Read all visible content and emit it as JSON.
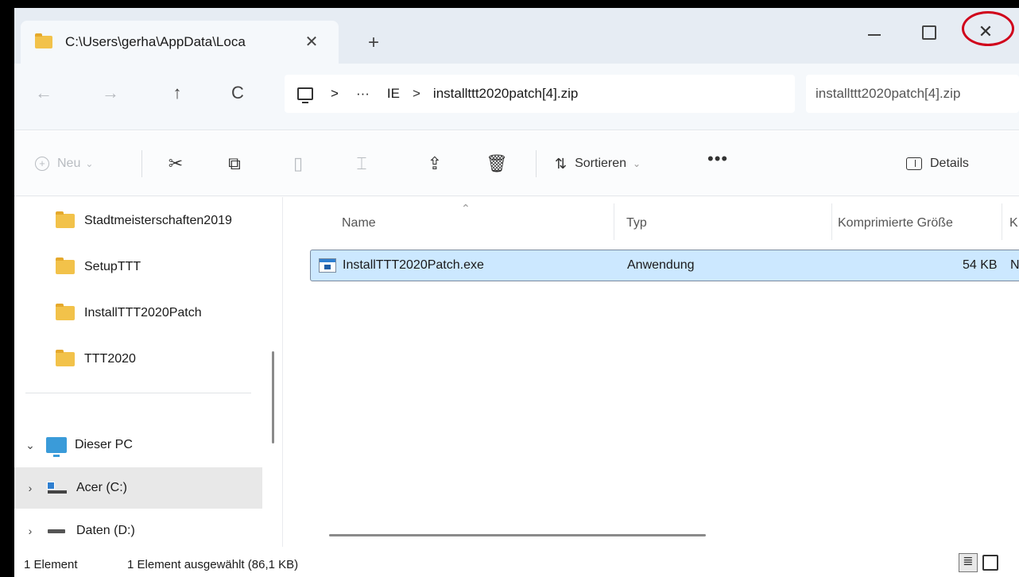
{
  "tab": {
    "title": "C:\\Users\\gerha\\AppData\\Loca",
    "close": "✕",
    "new_tab": "+"
  },
  "window_controls": {
    "close": "✕"
  },
  "nav": {
    "back": "←",
    "forward": "→",
    "up": "↑",
    "refresh": "C"
  },
  "address": {
    "separator": ">",
    "overflow": "···",
    "segment_ie": "IE",
    "segment_zip": "installttt2020patch[4].zip"
  },
  "search": {
    "placeholder": "installttt2020patch[4].zip"
  },
  "commands": {
    "new_label": "Neu",
    "cut_icon": "scissors-icon",
    "copy_icon": "copy-icon",
    "paste_icon": "paste-icon",
    "rename_icon": "rename-icon",
    "share_icon": "share-icon",
    "delete_icon": "trash-icon",
    "sort_label": "Sortieren",
    "more": "•••",
    "details_label": "Details"
  },
  "sidebar": {
    "folders": [
      {
        "label": "Stadtmeisterschaften2019"
      },
      {
        "label": "SetupTTT"
      },
      {
        "label": "InstallTTT2020Patch"
      },
      {
        "label": "TTT2020"
      }
    ],
    "this_pc": "Dieser PC",
    "drives": [
      {
        "label": "Acer (C:)"
      },
      {
        "label": "Daten (D:)"
      }
    ]
  },
  "columns": {
    "name": "Name",
    "type": "Typ",
    "compressed_size": "Komprimierte Größe",
    "next": "K"
  },
  "files": [
    {
      "name": "InstallTTT2020Patch.exe",
      "type": "Anwendung",
      "size": "54 KB",
      "extra": "N"
    }
  ],
  "status": {
    "count": "1 Element",
    "selection": "1 Element ausgewählt (86,1 KB)"
  },
  "colors": {
    "selection_bg": "#cce8ff",
    "folder": "#f2c24a",
    "annotation": "#d0021b"
  }
}
